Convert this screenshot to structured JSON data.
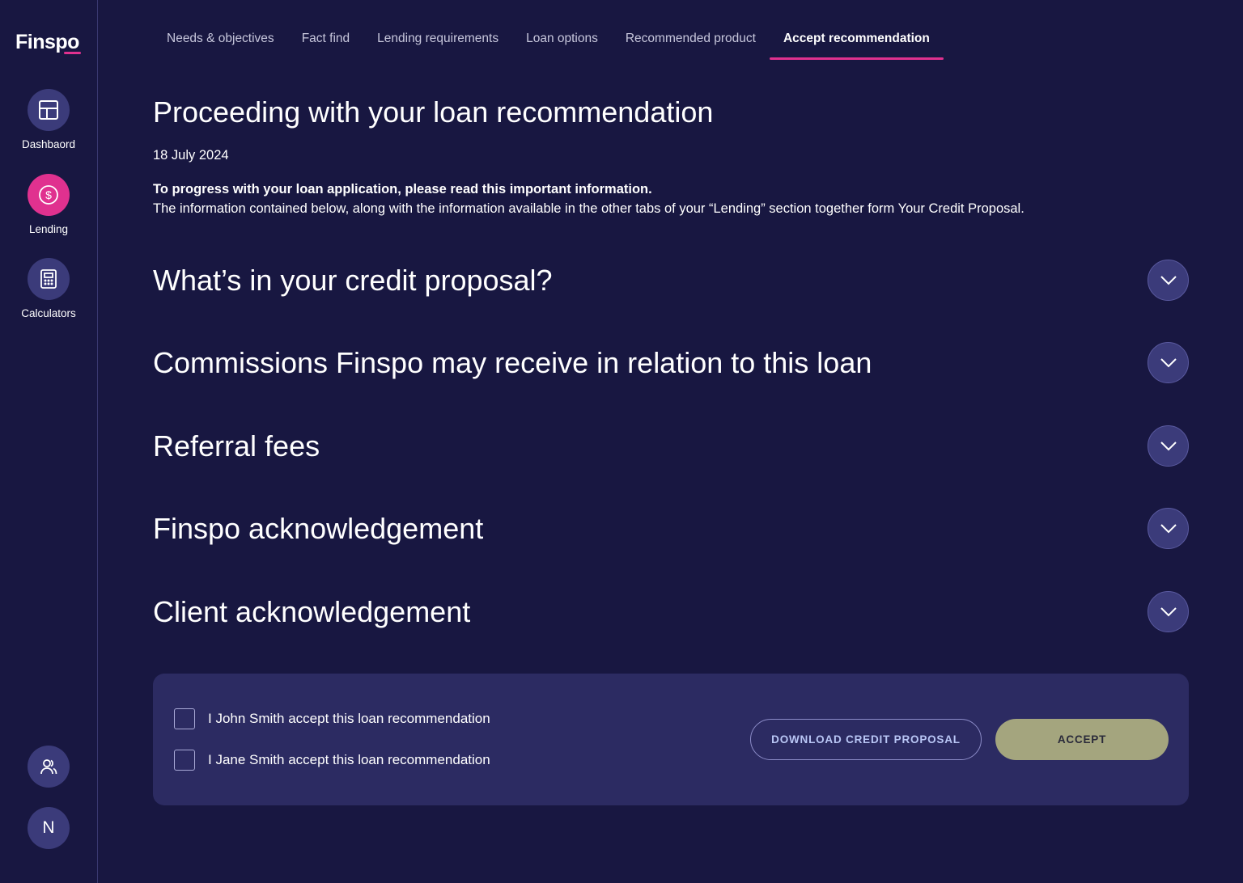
{
  "brand": {
    "logo_text": "Finspo",
    "accent_color": "#e0318f"
  },
  "sidebar": {
    "items": [
      {
        "label": "Dashbaord",
        "icon": "layout-icon",
        "active": false
      },
      {
        "label": "Lending",
        "icon": "dollar-icon",
        "active": true
      },
      {
        "label": "Calculators",
        "icon": "calculator-icon",
        "active": false
      }
    ],
    "bottom": {
      "profile_icon": "users-icon",
      "avatar_initial": "N"
    }
  },
  "tabs": [
    {
      "label": "Needs & objectives",
      "active": false
    },
    {
      "label": "Fact find",
      "active": false
    },
    {
      "label": "Lending requirements",
      "active": false
    },
    {
      "label": "Loan options",
      "active": false
    },
    {
      "label": "Recommended product",
      "active": false
    },
    {
      "label": "Accept recommendation",
      "active": true
    }
  ],
  "main": {
    "title": "Proceeding with your loan recommendation",
    "date": "18 July 2024",
    "info_bold": "To progress with your loan application, please read this important information.",
    "info_text": "The information contained below, along with the information available in the other tabs of your “Lending” section together form Your Credit Proposal."
  },
  "accordion": [
    {
      "title": "What’s in your credit proposal?",
      "icon": "chevron-down-icon"
    },
    {
      "title": "Commissions Finspo may receive in relation to this loan",
      "icon": "chevron-down-icon"
    },
    {
      "title": "Referral fees",
      "icon": "chevron-down-icon"
    },
    {
      "title": "Finspo acknowledgement",
      "icon": "chevron-down-icon"
    },
    {
      "title": "Client acknowledgement",
      "icon": "chevron-down-icon"
    }
  ],
  "accept_panel": {
    "checks": [
      {
        "label": "I John Smith accept this loan recommendation",
        "checked": false
      },
      {
        "label": "I Jane Smith accept this loan recommendation",
        "checked": false
      }
    ],
    "download_label": "DOWNLOAD CREDIT PROPOSAL",
    "accept_label": "ACCEPT"
  }
}
